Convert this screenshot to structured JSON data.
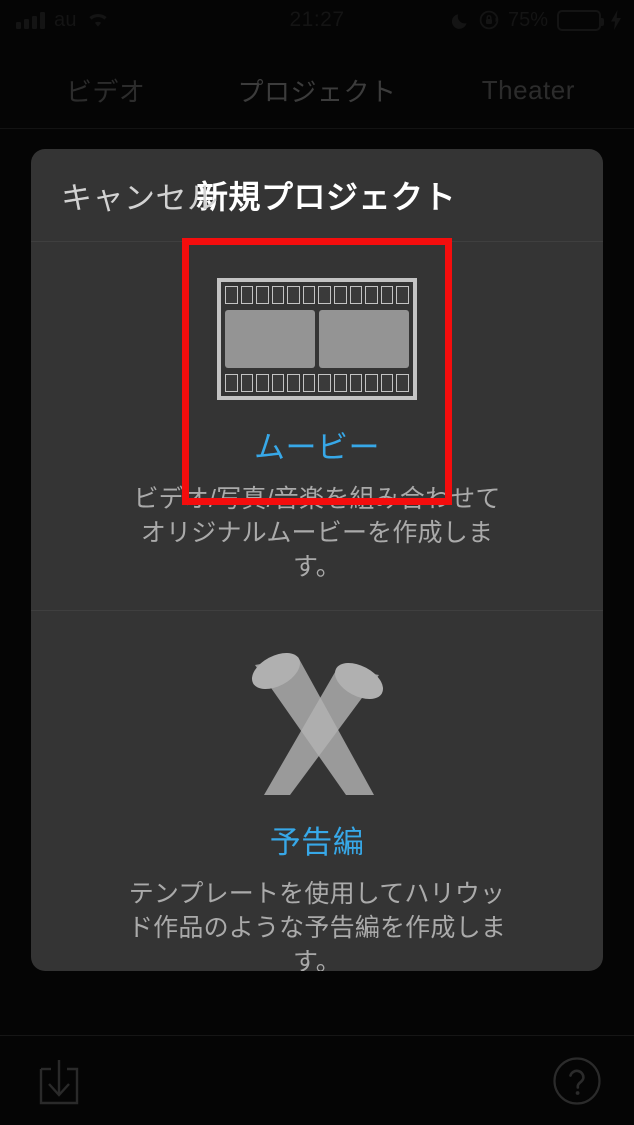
{
  "statusbar": {
    "carrier": "au",
    "time": "21:27",
    "battery_percent": "75%",
    "signal_icon": "signal-bars-icon",
    "wifi_icon": "wifi-icon",
    "dnd_icon": "moon-icon",
    "rotation_lock_icon": "rotation-lock-icon",
    "battery_icon": "battery-icon",
    "charging_icon": "lightning-bolt-icon",
    "battery_fill_color": "#4CD964"
  },
  "tabs": [
    {
      "label": "ビデオ",
      "selected": false
    },
    {
      "label": "プロジェクト",
      "selected": true
    },
    {
      "label": "Theater",
      "selected": false
    }
  ],
  "sheet": {
    "cancel_label": "キャンセル",
    "title": "新規プロジェクト",
    "options": [
      {
        "icon": "film-strip-icon",
        "label": "ムービー",
        "description": "ビデオ/写真/音楽を組み合わせてオリジナルムービーを作成します。",
        "highlighted": true
      },
      {
        "icon": "crossed-spotlights-icon",
        "label": "予告編",
        "description": "テンプレートを使用してハリウッド作品のような予告編を作成します。",
        "highlighted": false
      }
    ],
    "accent_color": "#37a8e8",
    "background_color": "#343434"
  },
  "annotation": {
    "color": "#f40d0d",
    "target": "ムービー"
  },
  "bottombar": {
    "import_icon": "import-download-icon",
    "help_icon": "help-question-icon"
  }
}
